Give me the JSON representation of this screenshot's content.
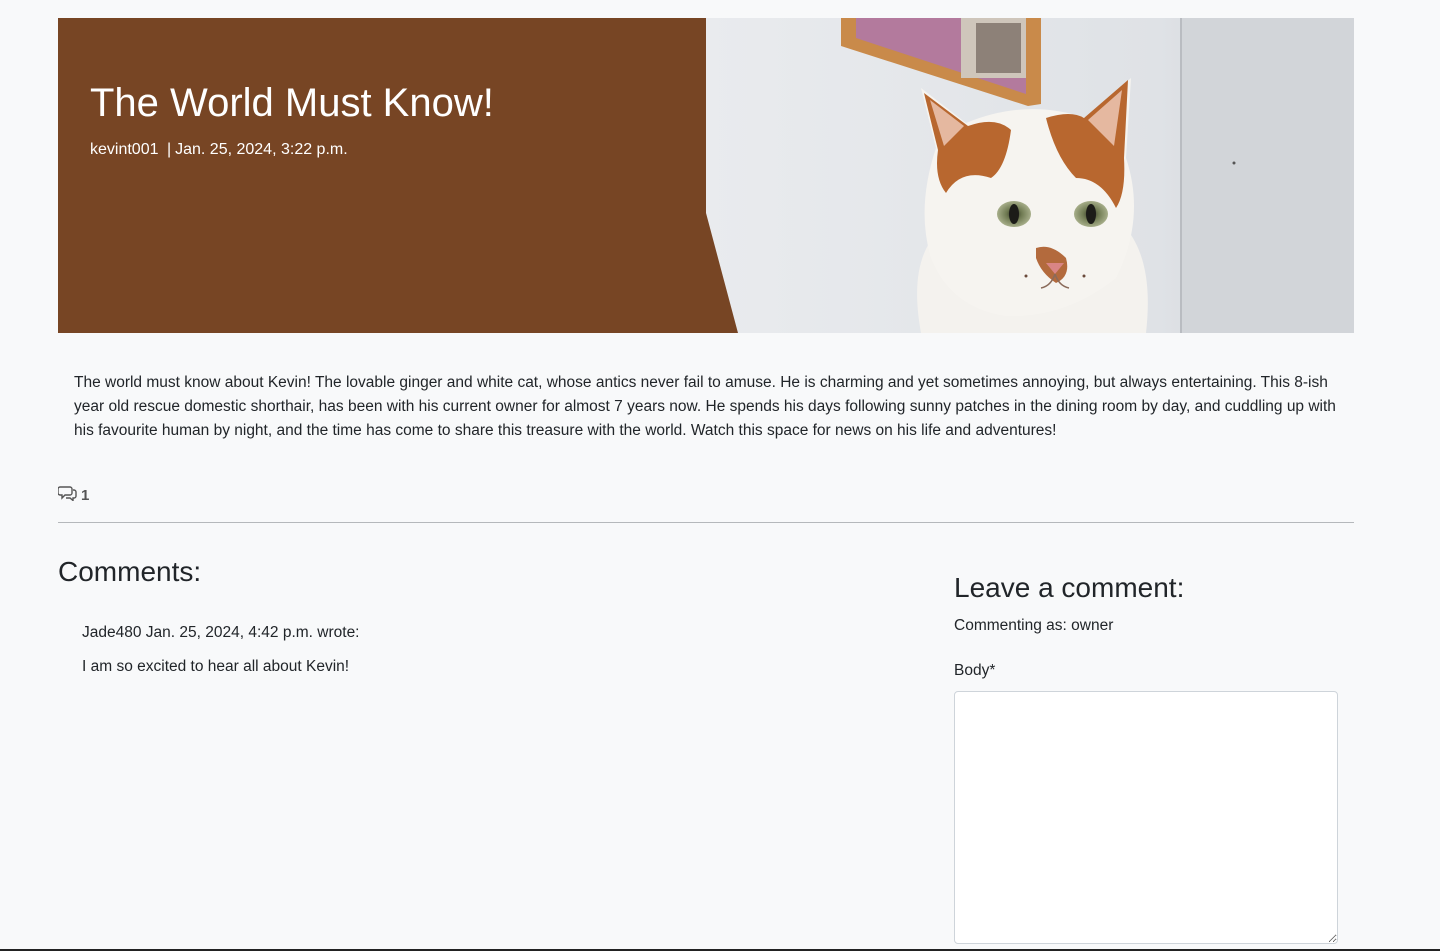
{
  "post": {
    "title": "The World Must Know!",
    "author": "kevint001",
    "separator": "|",
    "date": "Jan. 25, 2024, 3:22 p.m.",
    "body": "The world must know about Kevin! The lovable ginger and white cat, whose antics never fail to amuse. He is charming and yet sometimes annoying, but always entertaining. This 8-ish year old rescue domestic shorthair, has been with his current owner for almost 7 years now. He spends his days following sunny patches in the dining room by day, and cuddling up with his favourite human by night, and the time has come to share this treasure with the world. Watch this space for news on his life and adventures!",
    "comment_count": "1",
    "comment_icon": "comments-icon",
    "hero_color": "#774524"
  },
  "comments": {
    "heading": "Comments:",
    "items": [
      {
        "author": "Jade480",
        "date": "Jan. 25, 2024, 4:42 p.m.",
        "suffix": "wrote:",
        "text": "I am so excited to hear all about Kevin!"
      }
    ]
  },
  "comment_form": {
    "heading": "Leave a comment:",
    "commenting_as": "Commenting as: owner",
    "body_label": "Body*",
    "body_value": ""
  }
}
